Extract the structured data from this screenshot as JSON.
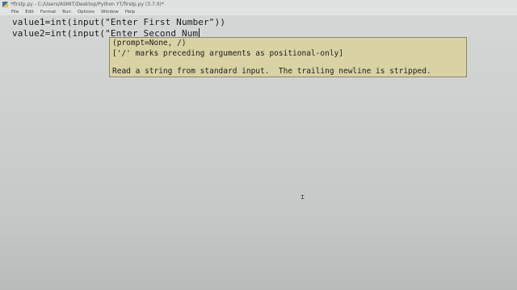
{
  "window": {
    "title": "*firstp.py - C:/Users/ASMIT/Desktop/Python YT/firstp.py (3.7.0)*",
    "icon": "python-idle-icon"
  },
  "menu": {
    "items": [
      "File",
      "Edit",
      "Format",
      "Run",
      "Options",
      "Window",
      "Help"
    ]
  },
  "editor": {
    "lines": [
      "value1=int(input(\"Enter First Number\"))",
      "value2=int(input(\"Enter Second Num"
    ]
  },
  "calltip": {
    "signature": "(prompt=None, /)",
    "note": "['/' marks preceding arguments as positional-only]",
    "doc": "Read a string from standard input.  The trailing newline is stripped."
  },
  "colors": {
    "calltip_background": "#d9d2a4",
    "editor_background": "#d6d8d8"
  },
  "icons": {
    "mouse_pointer": "text-ibeam-icon"
  }
}
